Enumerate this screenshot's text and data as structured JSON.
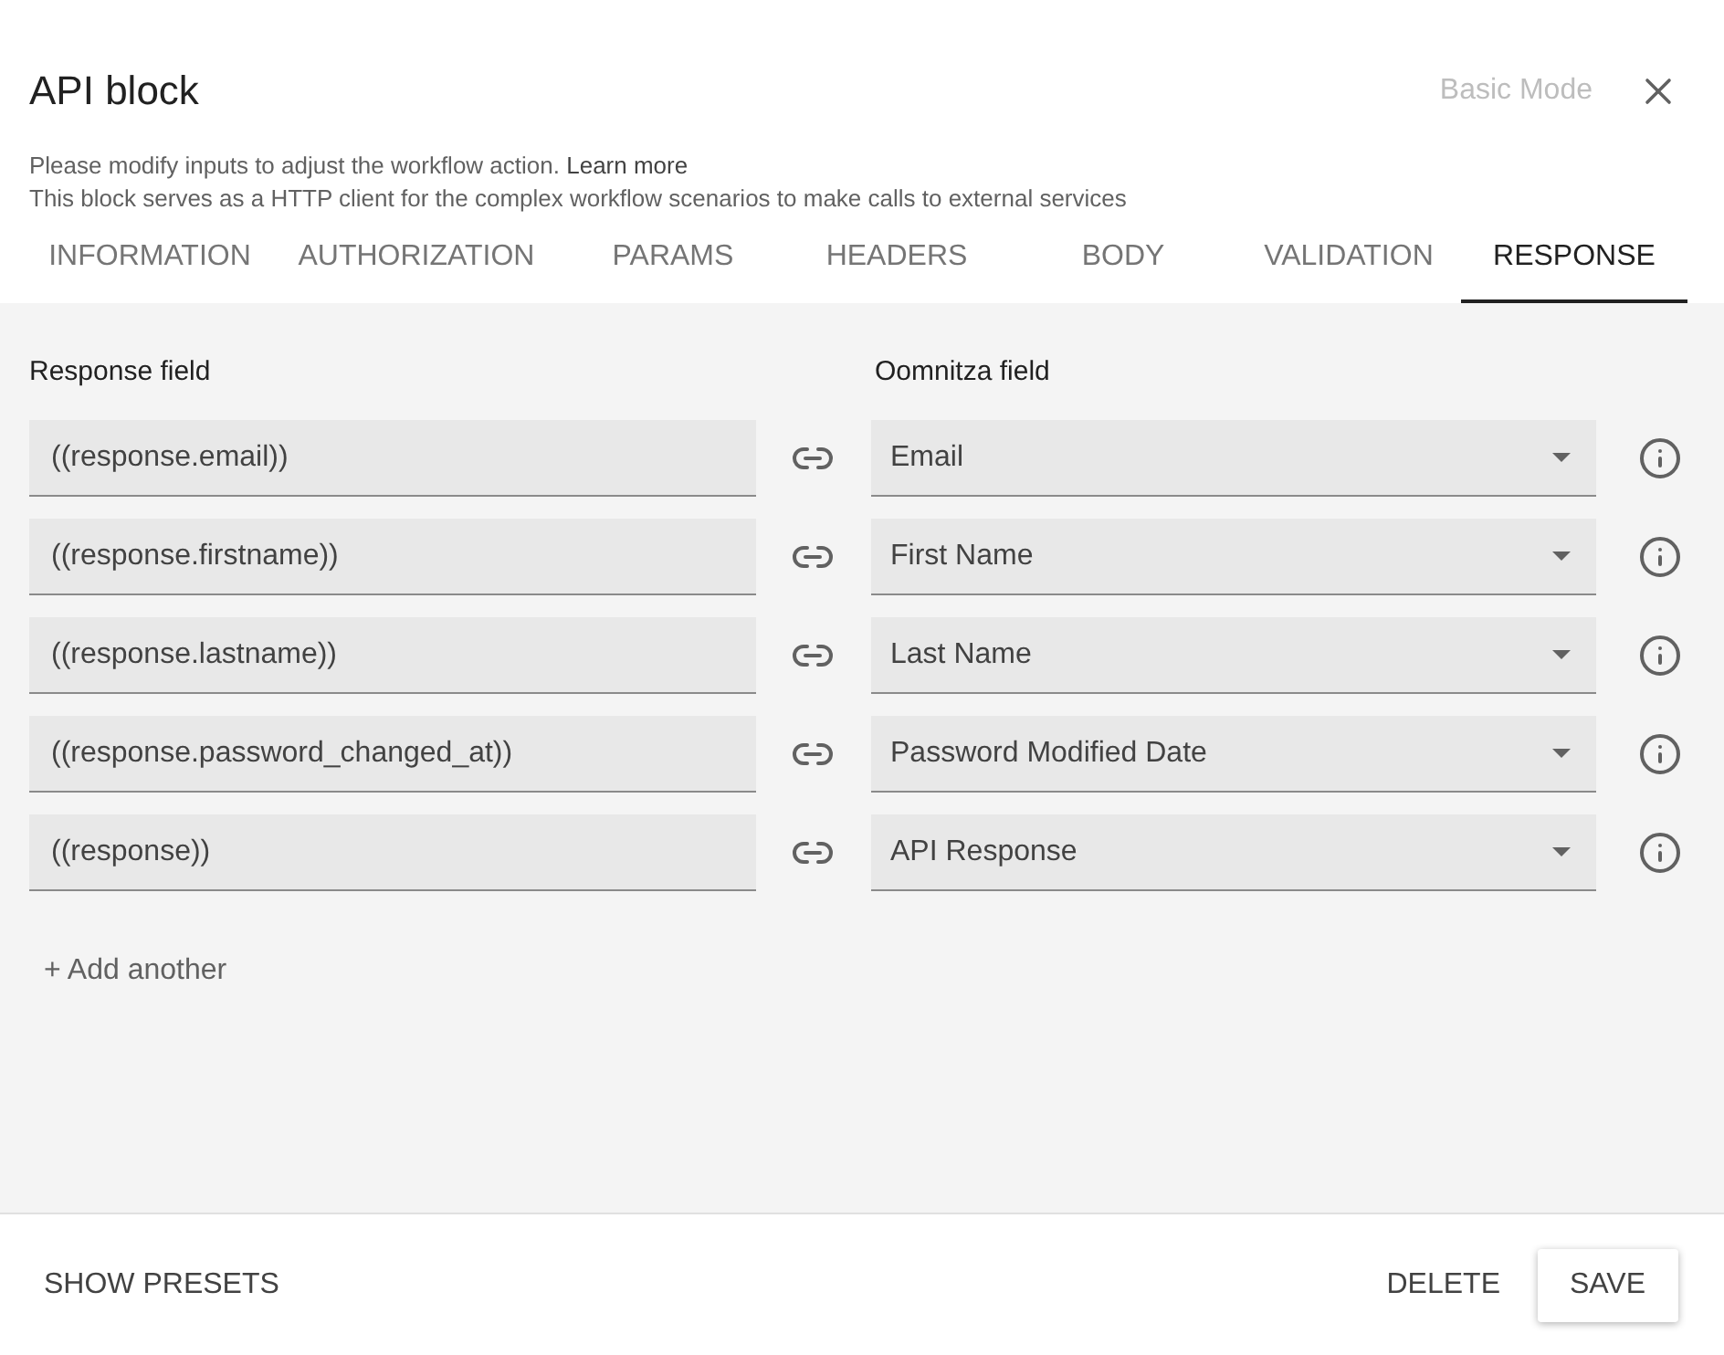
{
  "dialog": {
    "title": "API block",
    "mode_button": "Basic Mode"
  },
  "description": {
    "line_1": "Please modify inputs to adjust the workflow action.",
    "link": "Learn more",
    "line_2": "This block serves as a HTTP client for the complex workflow scenarios to make calls to external services"
  },
  "tabs": [
    {
      "label": "INFORMATION",
      "selected": false
    },
    {
      "label": "AUTHORIZATION",
      "selected": false
    },
    {
      "label": "PARAMS",
      "selected": false
    },
    {
      "label": "HEADERS",
      "selected": false
    },
    {
      "label": "BODY",
      "selected": false
    },
    {
      "label": "VALIDATION",
      "selected": false
    },
    {
      "label": "RESPONSE",
      "selected": true
    }
  ],
  "mapping": {
    "columns": [
      "Response field",
      "Oomnitza field"
    ],
    "rows": [
      {
        "response_field": "((response.email))",
        "oomnitza_field": "Email"
      },
      {
        "response_field": "((response.firstname))",
        "oomnitza_field": "First Name"
      },
      {
        "response_field": "((response.lastname))",
        "oomnitza_field": "Last Name"
      },
      {
        "response_field": "((response.password_changed_at))",
        "oomnitza_field": "Password Modified Date"
      },
      {
        "response_field": "((response))",
        "oomnitza_field": "API Response"
      }
    ],
    "add_button": "+ Add another"
  },
  "footer": {
    "show_presets": "SHOW PRESETS",
    "delete": "DELETE",
    "save": "SAVE"
  }
}
